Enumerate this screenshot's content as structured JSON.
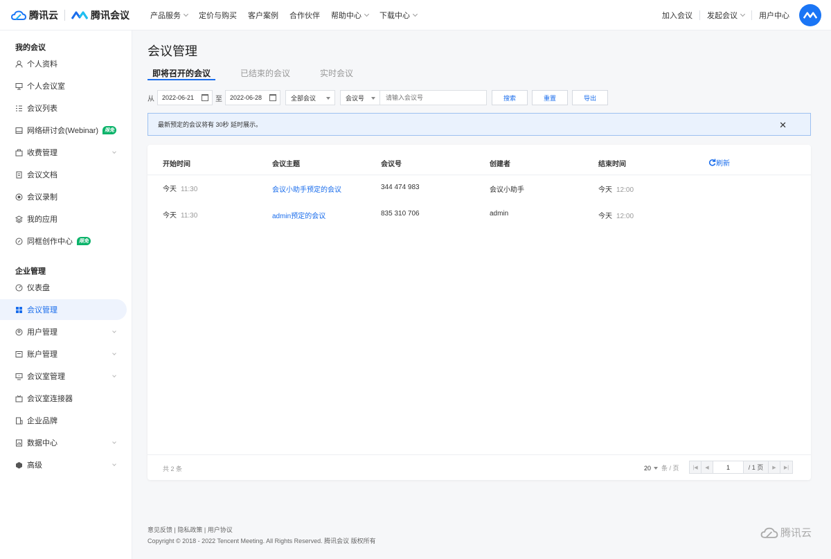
{
  "brand": {
    "cloud_name": "腾讯云",
    "meeting_name": "腾讯会议"
  },
  "nav": {
    "items": [
      "产品服务",
      "定价与购买",
      "客户案例",
      "合作伙伴",
      "帮助中心",
      "下载中心"
    ]
  },
  "nav_right": {
    "join": "加入会议",
    "start": "发起会议",
    "user_center": "用户中心"
  },
  "sidebar": {
    "group1": "我的会议",
    "group1_items": [
      {
        "label": "个人资料",
        "icon": "user-icon"
      },
      {
        "label": "个人会议室",
        "icon": "meeting-room-icon"
      },
      {
        "label": "会议列表",
        "icon": "list-icon"
      },
      {
        "label": "网络研讨会(Webinar)",
        "icon": "webinar-icon",
        "badge": "限免"
      },
      {
        "label": "收费管理",
        "icon": "billing-icon"
      },
      {
        "label": "会议文档",
        "icon": "document-icon"
      },
      {
        "label": "会议录制",
        "icon": "record-icon"
      },
      {
        "label": "我的应用",
        "icon": "apps-icon"
      },
      {
        "label": "同框创作中心",
        "icon": "creation-icon",
        "badge": "限免"
      }
    ],
    "group2": "企业管理",
    "group2_items": [
      {
        "label": "仪表盘",
        "icon": "dashboard-icon"
      },
      {
        "label": "会议管理",
        "icon": "grid-icon",
        "active": true
      },
      {
        "label": "用户管理",
        "icon": "users-icon"
      },
      {
        "label": "账户管理",
        "icon": "account-icon"
      },
      {
        "label": "会议室管理",
        "icon": "room-manage-icon"
      },
      {
        "label": "会议室连接器",
        "icon": "connector-icon"
      },
      {
        "label": "企业品牌",
        "icon": "brand-icon"
      },
      {
        "label": "数据中心",
        "icon": "data-icon"
      },
      {
        "label": "高级",
        "icon": "advanced-icon"
      }
    ]
  },
  "main": {
    "title": "会议管理",
    "tabs": [
      "即将召开的会议",
      "已结束的会议",
      "实时会议"
    ],
    "filters": {
      "from_label": "从",
      "start_date": "2022-06-21",
      "to_label": "至",
      "end_date": "2022-06-28",
      "scope": "全部会议",
      "field": "会议号",
      "placeholder": "请输入会议号",
      "search": "搜索",
      "reset": "重置",
      "export": "导出"
    },
    "notice": "最新预定的会议将有 30秒 延时展示。",
    "table": {
      "headers": [
        "开始时间",
        "会议主题",
        "会议号",
        "创建者",
        "结束时间"
      ],
      "refresh": "刷新",
      "rows": [
        {
          "start_day": "今天",
          "start_time": "11:30",
          "topic": "会议小助手预定的会议",
          "number": "344 474 983",
          "creator": "会议小助手",
          "end_day": "今天",
          "end_time": "12:00"
        },
        {
          "start_day": "今天",
          "start_time": "11:30",
          "topic": "admin预定的会议",
          "number": "835 310 706",
          "creator": "admin",
          "end_day": "今天",
          "end_time": "12:00"
        }
      ]
    },
    "pagination": {
      "total": "共 2 条",
      "page_size": "20",
      "per_page_unit": "条 / 页",
      "current_page": "1",
      "page_total": "/ 1 页"
    }
  },
  "footer": {
    "links": [
      "意见反馈",
      "隐私政策",
      "用户协议"
    ],
    "copyright": "Copyright © 2018 - 2022 Tencent Meeting. All Rights Reserved. 腾讯会议 版权所有",
    "logo_text": "腾讯云"
  },
  "colors": {
    "accent": "#1a6dec",
    "badge": "#0bb36a",
    "avatar": "#1a75f5"
  }
}
